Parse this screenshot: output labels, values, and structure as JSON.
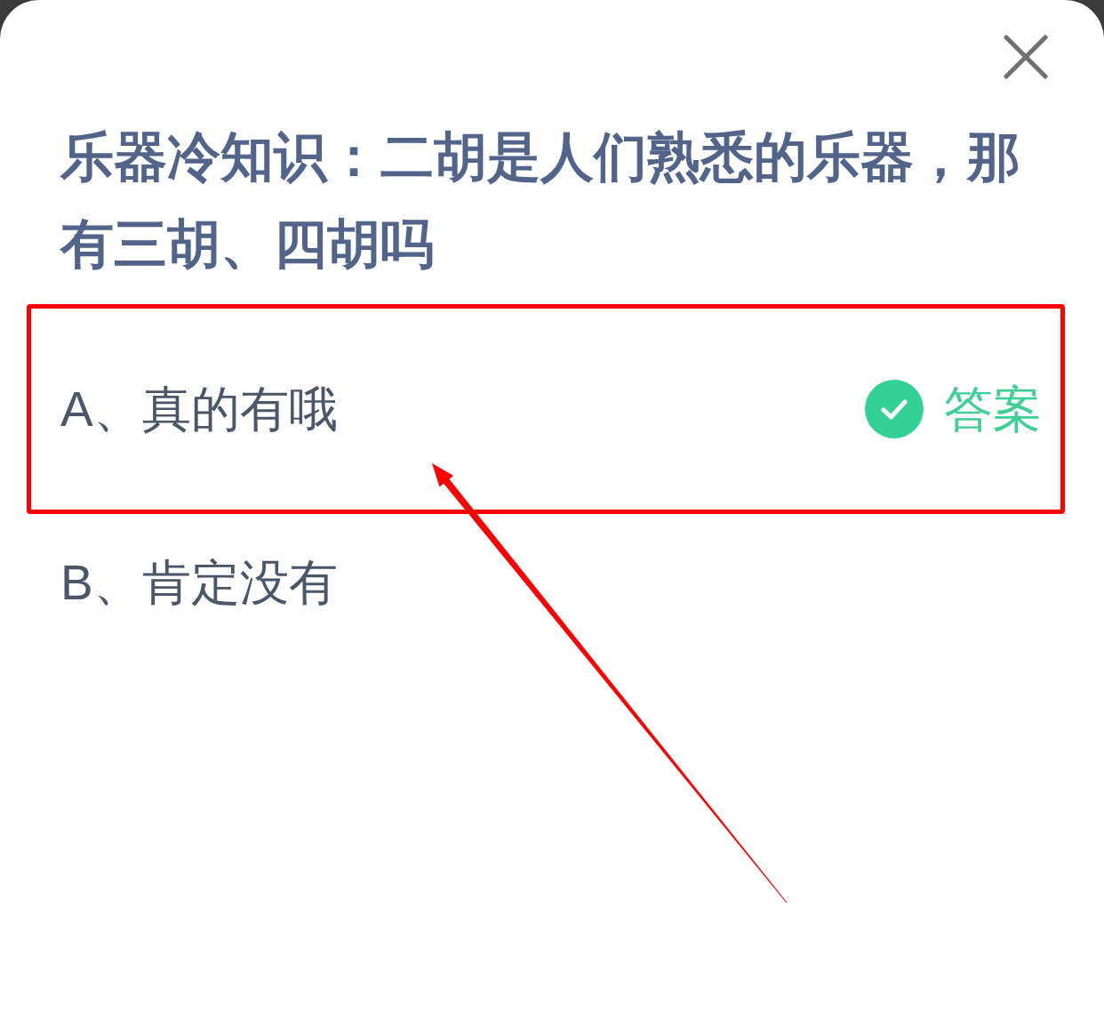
{
  "question": {
    "title": "乐器冷知识：二胡是人们熟悉的乐器，那有三胡、四胡吗"
  },
  "options": [
    {
      "label": "A、真的有哦",
      "correct": true,
      "answer_label": "答案",
      "highlighted": true
    },
    {
      "label": "B、肯定没有",
      "correct": false,
      "highlighted": false
    }
  ]
}
